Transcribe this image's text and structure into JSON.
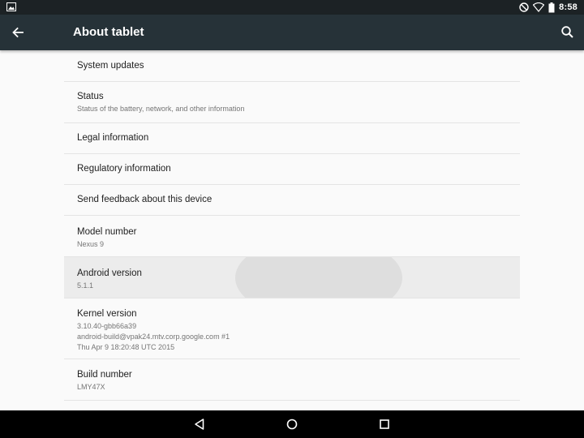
{
  "status_bar": {
    "time": "8:58",
    "icons": [
      "image-notification-icon",
      "do-not-disturb-icon",
      "wifi-icon",
      "battery-icon"
    ]
  },
  "app_bar": {
    "title": "About tablet",
    "background": "#263238",
    "back_icon": "arrow-back-icon",
    "search_icon": "search-icon"
  },
  "items": [
    {
      "title": "System updates",
      "summary": ""
    },
    {
      "title": "Status",
      "summary": "Status of the battery, network, and other information"
    },
    {
      "title": "Legal information",
      "summary": ""
    },
    {
      "title": "Regulatory information",
      "summary": ""
    },
    {
      "title": "Send feedback about this device",
      "summary": ""
    },
    {
      "title": "Model number",
      "summary": "Nexus 9"
    },
    {
      "title": "Android version",
      "summary": "5.1.1"
    },
    {
      "title": "Kernel version",
      "summary": "3.10.40-gbb66a39\nandroid-build@vpak24.mtv.corp.google.com #1\nThu Apr 9 18:20:48 UTC 2015"
    },
    {
      "title": "Build number",
      "summary": "LMY47X"
    }
  ],
  "nav_bar": {
    "back": "nav-back-icon",
    "home": "nav-home-icon",
    "recents": "nav-recents-icon"
  }
}
